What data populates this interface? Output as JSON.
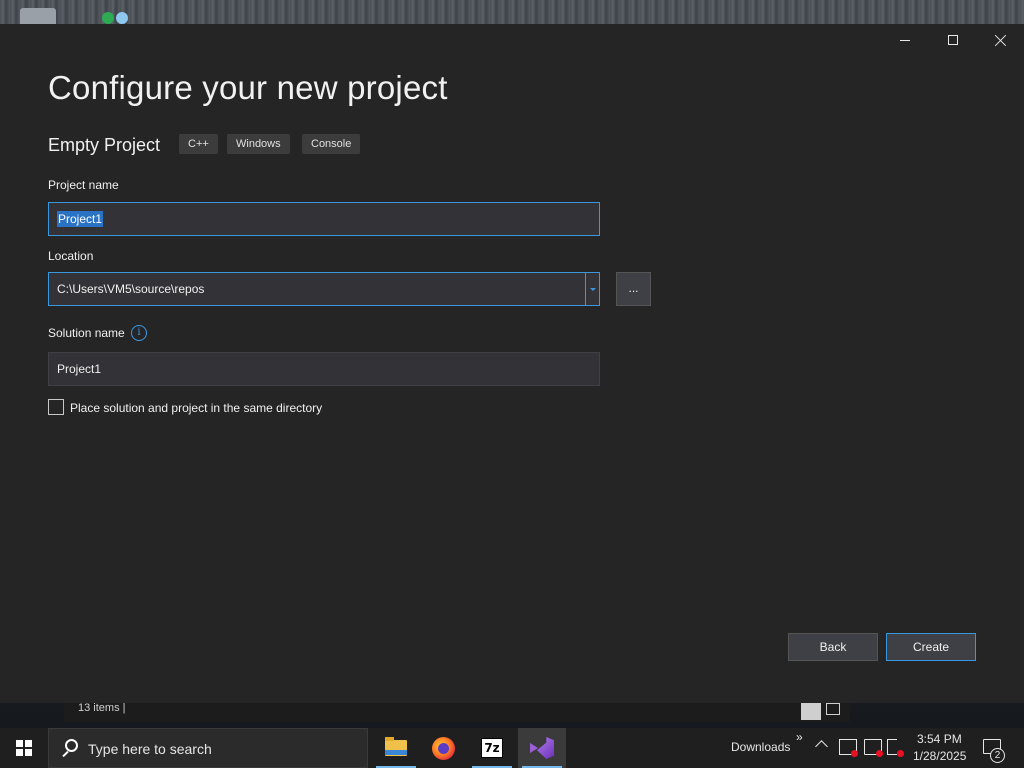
{
  "dialog": {
    "title": "Configure your new project",
    "template_name": "Empty Project",
    "tags": [
      "C++",
      "Windows",
      "Console"
    ],
    "project_name": {
      "label": "Project name",
      "value": "Project1"
    },
    "location": {
      "label": "Location",
      "value": "C:\\Users\\VM5\\source\\repos",
      "browse_label": "..."
    },
    "solution_name": {
      "label": "Solution name",
      "info_icon": "i",
      "value": "Project1"
    },
    "same_directory": {
      "label": "Place solution and project in the same directory",
      "checked": false
    },
    "buttons": {
      "back": "Back",
      "create": "Create"
    }
  },
  "explorer_behind": {
    "status": "13 items  |"
  },
  "taskbar": {
    "search_placeholder": "Type here to search",
    "apps": [
      "file-explorer",
      "firefox",
      "7-zip",
      "visual-studio"
    ],
    "seven_zip_label": "7z",
    "tray": {
      "downloads_label": "Downloads",
      "chevron": "»",
      "time": "3:54 PM",
      "date": "1/28/2025",
      "notification_count": "2"
    }
  },
  "colors": {
    "accent": "#3a96dd",
    "dialog_bg": "#252526",
    "field_bg": "#333337",
    "selection": "#2a72c4"
  }
}
